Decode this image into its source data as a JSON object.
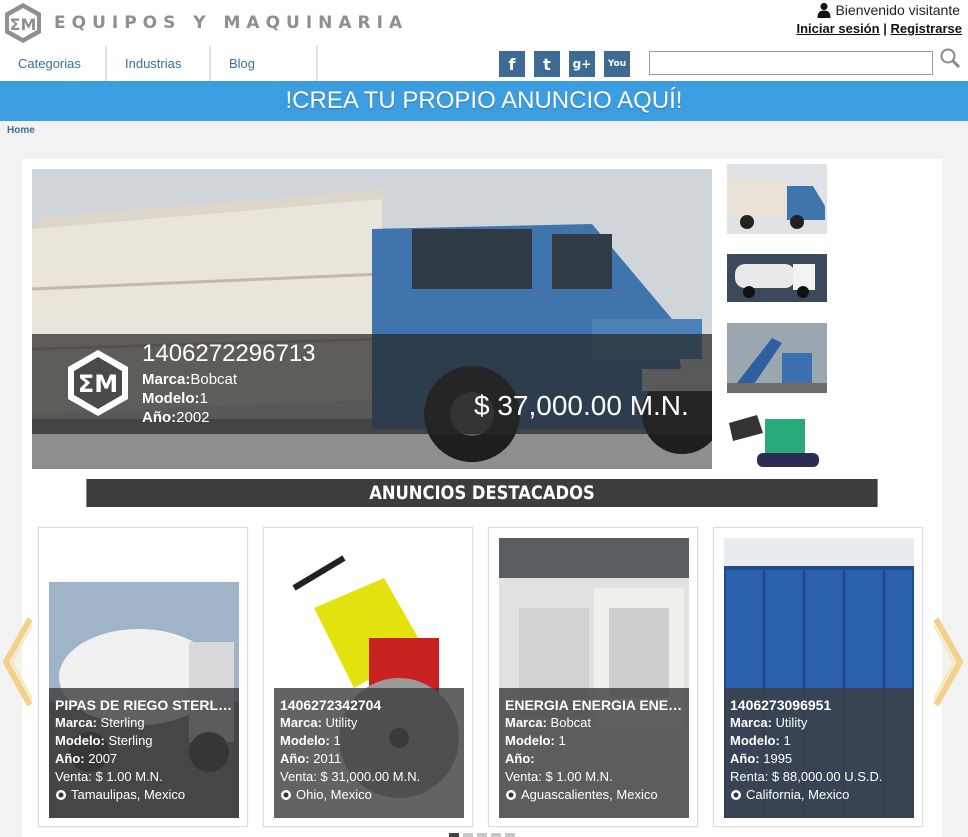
{
  "header": {
    "logo_text": "EQUIPOS Y MAQUINARIA",
    "welcome": "Bienvenido visitante",
    "login": "Iniciar sesión",
    "separator": "|",
    "register": "Registrarse"
  },
  "nav": {
    "items": [
      {
        "label": "Categorias"
      },
      {
        "label": "Industrias"
      },
      {
        "label": "Blog"
      }
    ]
  },
  "social": {
    "icons": [
      "facebook-icon",
      "twitter-icon",
      "google-plus-icon",
      "youtube-icon"
    ]
  },
  "search": {
    "placeholder": ""
  },
  "banner": {
    "text": "!CREA TU PROPIO ANUNCIO AQUÍ!"
  },
  "breadcrumb": {
    "home": "Home"
  },
  "hero": {
    "id": "1406272296713",
    "marca_label": "Marca:",
    "marca": "Bobcat",
    "modelo_label": "Modelo:",
    "modelo": "1",
    "anio_label": "Año:",
    "anio": "2002",
    "price": "$ 37,000.00 M.N."
  },
  "section": {
    "title": "ANUNCIOS DESTACADOS"
  },
  "listings": [
    {
      "title": "PIPAS DE RIEGO STERLING",
      "marca_label": "Marca:",
      "marca": "Sterling",
      "modelo_label": "Modelo:",
      "modelo": "Sterling",
      "anio_label": "Año:",
      "anio": "2007",
      "price": "Venta: $ 1.00 M.N.",
      "location": "Tamaulipas, Mexico"
    },
    {
      "title": "1406272342704",
      "marca_label": "Marca:",
      "marca": "Utility",
      "modelo_label": "Modelo:",
      "modelo": "1",
      "anio_label": "Año:",
      "anio": "2011",
      "price": "Venta: $ 31,000.00 M.N.",
      "location": "Ohio, Mexico"
    },
    {
      "title": "ENERGIA ENERGIA ENERGIA",
      "marca_label": "Marca:",
      "marca": "Bobcat",
      "modelo_label": "Modelo:",
      "modelo": "1",
      "anio_label": "Año:",
      "anio": "",
      "price": "Venta: $ 1.00 M.N.",
      "location": "Aguascalientes, Mexico"
    },
    {
      "title": "1406273096951",
      "marca_label": "Marca:",
      "marca": "Utility",
      "modelo_label": "Modelo:",
      "modelo": "1",
      "anio_label": "Año:",
      "anio": "1995",
      "price": "Renta: $ 88,000.00 U.S.D.",
      "location": "California, Mexico"
    }
  ],
  "colors": {
    "banner": "#3c9de0",
    "nav_link": "#3b6e9c",
    "section_bar": "#3d3d3d",
    "arrow": "#f5d08a"
  }
}
